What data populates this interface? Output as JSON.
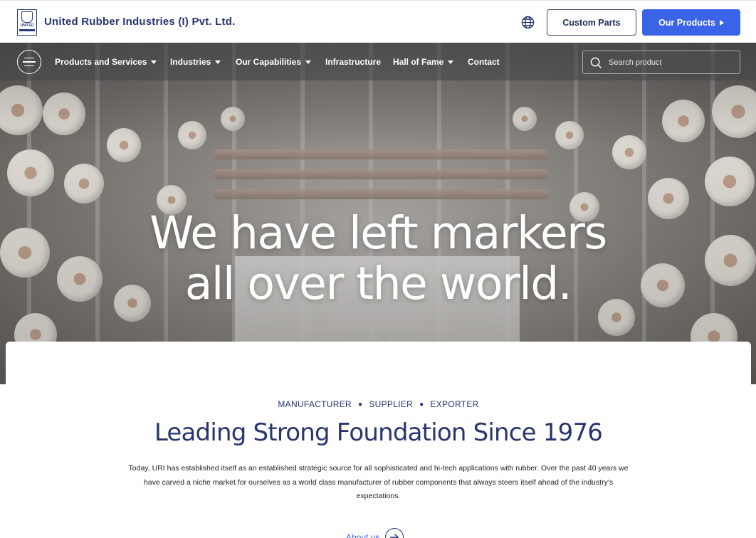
{
  "header": {
    "logo_text": "UNITED",
    "brand": "United Rubber Industries (I) Pvt. Ltd.",
    "custom_parts_label": "Custom Parts",
    "our_products_label": "Our Products"
  },
  "nav": {
    "items": [
      {
        "label": "Products and Services",
        "dropdown": true
      },
      {
        "label": "Industries",
        "dropdown": true
      },
      {
        "label": "Our Capabilities",
        "dropdown": true
      },
      {
        "label": "Infrastructure",
        "dropdown": false
      },
      {
        "label": "Hall of Fame",
        "dropdown": true
      },
      {
        "label": "Contact",
        "dropdown": false
      }
    ],
    "search_placeholder": "Search product"
  },
  "hero": {
    "line1": "We have left markers",
    "line2": "all over the world."
  },
  "intro": {
    "tags": [
      "MANUFACTURER",
      "SUPPLIER",
      "EXPORTER"
    ],
    "headline": "Leading Strong Foundation Since 1976",
    "description": "Today, URI has established itself as an established strategic source for all sophisticated and hi-tech applications with rubber. Over the past 40 years we have carved a niche market for ourselves as a world class manufacturer of rubber components that always steers itself ahead of the industry's expectations.",
    "about_label": "About us"
  },
  "colors": {
    "brand_navy": "#28356f",
    "accent_blue": "#3a63e8"
  }
}
